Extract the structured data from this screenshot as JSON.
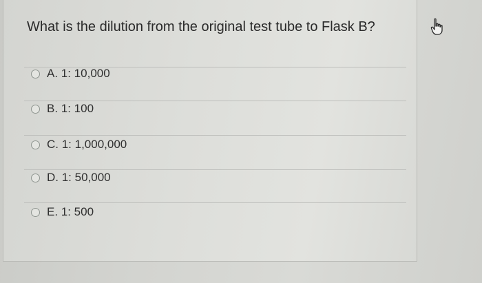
{
  "question": {
    "text": "What is the dilution from the original test tube to Flask B?"
  },
  "options": [
    {
      "label": "A. 1: 10,000"
    },
    {
      "label": "B. 1: 100"
    },
    {
      "label": "C. 1: 1,000,000"
    },
    {
      "label": "D. 1: 50,000"
    },
    {
      "label": "E. 1: 500"
    }
  ],
  "icons": {
    "pointer": "hand-pointer-icon",
    "radio": "radio-unchecked-icon"
  }
}
